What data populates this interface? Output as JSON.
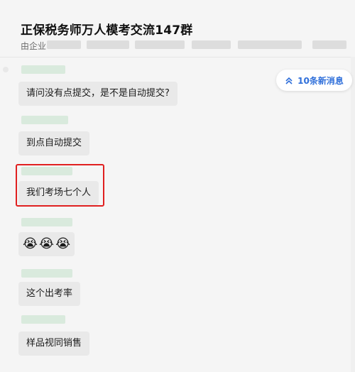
{
  "header": {
    "title": "正保税务师万人模考交流147群",
    "subtitle_prefix": "由企业"
  },
  "new_messages_button": {
    "label": "10条新消息",
    "icon": "double-chevron-up-icon"
  },
  "messages": [
    {
      "text": "请问没有点提交，是不是自动提交?"
    },
    {
      "text": "到点自动提交"
    },
    {
      "text": "我们考场七个人",
      "highlighted": true
    },
    {
      "emojis": [
        "😭",
        "😭",
        "😭"
      ]
    },
    {
      "text": "这个出考率"
    },
    {
      "text": "样品视同销售"
    }
  ],
  "colors": {
    "accent": "#2f6fda",
    "highlight_border": "#e02020",
    "bubble": "#e9e9e9"
  }
}
